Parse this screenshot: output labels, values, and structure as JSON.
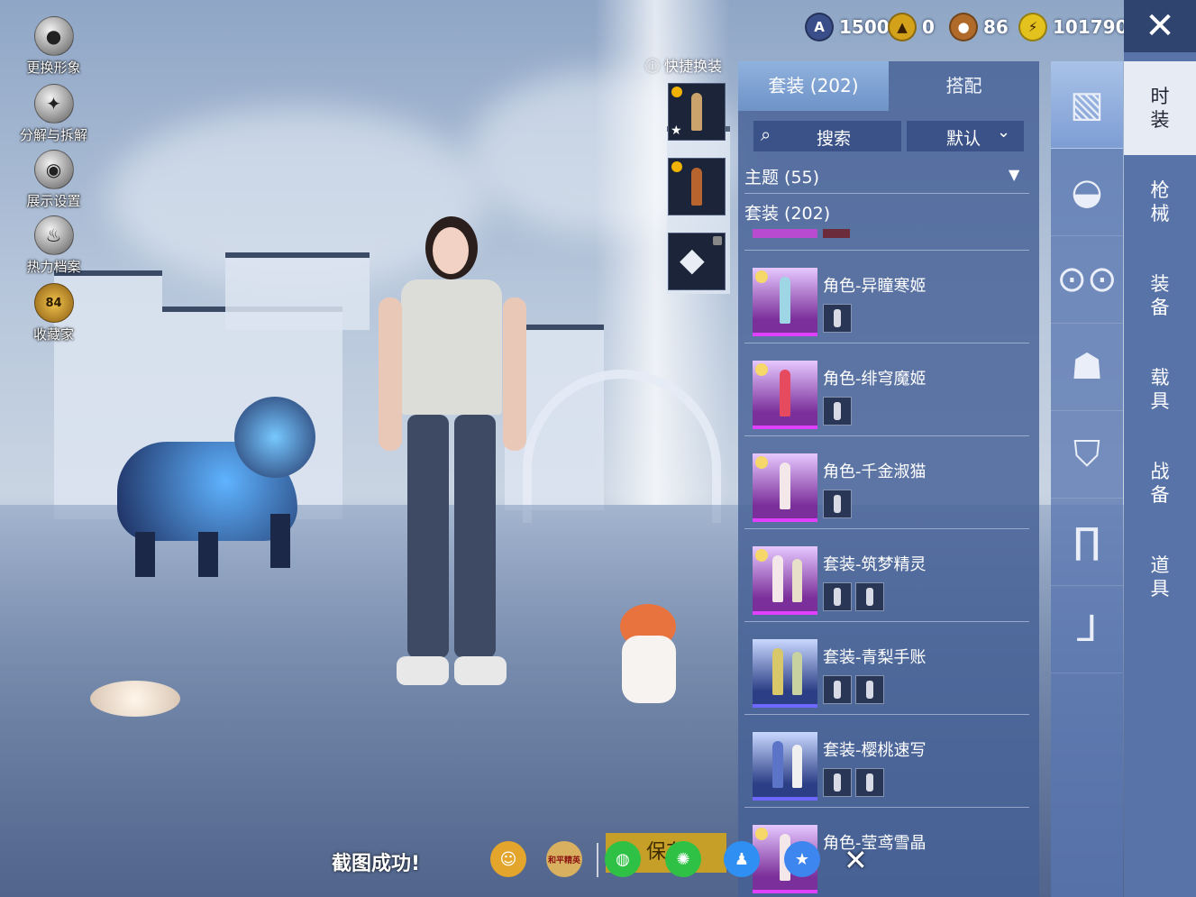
{
  "left_menu": [
    {
      "label": "更换形象",
      "icon": "avatar-icon"
    },
    {
      "label": "分解与拆解",
      "icon": "puzzle-icon"
    },
    {
      "label": "展示设置",
      "icon": "eye-icon"
    },
    {
      "label": "热力档案",
      "icon": "flame-icon"
    },
    {
      "label": "收藏家",
      "icon": "collector-badge-icon",
      "badge": "84"
    }
  ],
  "currencies": [
    {
      "icon": "ag-coin-icon",
      "value": "1500",
      "color": "#3a4f8a"
    },
    {
      "icon": "gold-token-icon",
      "value": "0",
      "color": "#d4a21a"
    },
    {
      "icon": "bronze-coin-icon",
      "value": "86",
      "color": "#b06a2a"
    },
    {
      "icon": "lightning-coin-icon",
      "value": "101790",
      "color": "#e3c21d"
    }
  ],
  "quick_change": {
    "label": "快捷换装"
  },
  "panel": {
    "tabs": [
      "套装 (202)",
      "搭配"
    ],
    "search_label": "搜索",
    "sort_value": "默认",
    "section_theme": "主题 (55)",
    "section_suit": "套装 (202)",
    "items": [
      {
        "name": "角色-异瞳寒姬",
        "style": "purple"
      },
      {
        "name": "角色-绯穹魔姬",
        "style": "purple"
      },
      {
        "name": "角色-千金淑猫",
        "style": "purple"
      },
      {
        "name": "套装-筑梦精灵",
        "style": "purple"
      },
      {
        "name": "套装-青梨手账",
        "style": "blue"
      },
      {
        "name": "套装-樱桃速写",
        "style": "blue"
      },
      {
        "name": "角色-莹鸢雪晶",
        "style": "purple"
      }
    ]
  },
  "categories": [
    "outfit-icon",
    "cap-icon",
    "glasses-icon",
    "mask-icon",
    "jacket-icon",
    "pants-icon",
    "boots-icon"
  ],
  "vertical_tabs": [
    "时装",
    "枪械",
    "装备",
    "载具",
    "战备",
    "道具"
  ],
  "bottom": {
    "screenshot_msg": "截图成功!",
    "save_label": "保存",
    "share_icons": [
      "avatar-share-icon",
      "game-logo-icon",
      "wechat-icon",
      "moments-icon",
      "qq-icon",
      "qzone-icon"
    ],
    "game_logo_text": "和平精英"
  }
}
